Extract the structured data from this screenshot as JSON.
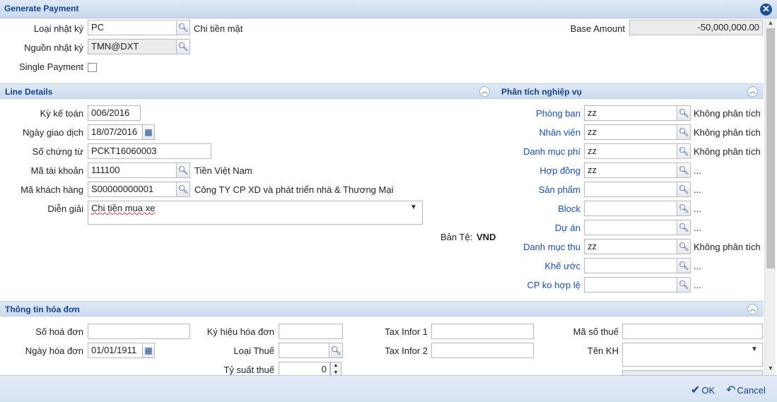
{
  "window": {
    "title": "Generate Payment"
  },
  "header": {
    "loai_nhat_ky": {
      "label": "Loại nhật ký",
      "value": "PC",
      "desc": "Chi tiền mặt"
    },
    "nguon_nhat_ky": {
      "label": "Nguồn nhật ký",
      "value": "TMN@DXT"
    },
    "single_payment": {
      "label": "Single Payment",
      "checked": false
    },
    "base_amount": {
      "label": "Base Amount",
      "value": "-50,000,000.00"
    }
  },
  "line_details": {
    "title": "Line Details",
    "ky_ke_toan": {
      "label": "Kỳ kế toán",
      "value": "006/2016"
    },
    "ngay_giao_dich": {
      "label": "Ngày giao dịch",
      "value": "18/07/2016"
    },
    "so_chung_tu": {
      "label": "Số chứng từ",
      "value": "PCKT16060003"
    },
    "ma_tai_khoan": {
      "label": "Mã tài khoản",
      "value": "111100",
      "desc": "Tiền Việt Nam"
    },
    "ma_khach_hang": {
      "label": "Mã khách hàng",
      "value": "S00000000001",
      "desc": "Công TY CP XD và phát triển nhà & Thương Mại"
    },
    "dien_giai": {
      "label": "Diễn giải",
      "value": "Chi tiền mua xe"
    },
    "ban_te": {
      "label": "Bản Tệ:",
      "value": "VND"
    }
  },
  "analysis": {
    "title": "Phân tích nghiệp vụ",
    "rows": [
      {
        "label": "Phòng ban",
        "value": "zz",
        "desc": "Không phân tích"
      },
      {
        "label": "Nhân viên",
        "value": "zz",
        "desc": "Không phân tích"
      },
      {
        "label": "Danh mục phí",
        "value": "zz",
        "desc": "Không phân tích"
      },
      {
        "label": "Hợp đồng",
        "value": "zz",
        "desc": "..."
      },
      {
        "label": "Sản phẩm",
        "value": "",
        "desc": "..."
      },
      {
        "label": "Block",
        "value": "",
        "desc": "..."
      },
      {
        "label": "Dự án",
        "value": "",
        "desc": "..."
      },
      {
        "label": "Danh mục thu",
        "value": "zz",
        "desc": "Không phân tích"
      },
      {
        "label": "Khế ước",
        "value": "",
        "desc": "..."
      },
      {
        "label": "CP ko hợp lệ",
        "value": "",
        "desc": "..."
      }
    ]
  },
  "invoice": {
    "title": "Thông tin hóa đơn",
    "so_hoa_don": {
      "label": "Số hoá đơn",
      "value": ""
    },
    "ngay_hoa_don": {
      "label": "Ngày hóa đơn",
      "value": "01/01/1911"
    },
    "ky_hieu_hoa_don": {
      "label": "Ký hiệu hóa đơn",
      "value": ""
    },
    "loai_thue": {
      "label": "Loại Thuế",
      "value": ""
    },
    "ty_suat_thue": {
      "label": "Tỷ suất thuế",
      "value": "0"
    },
    "tax_infor_1": {
      "label": "Tax Infor 1",
      "value": ""
    },
    "tax_infor_2": {
      "label": "Tax Infor 2",
      "value": ""
    },
    "ma_so_thue": {
      "label": "Mã số thuế",
      "value": ""
    },
    "ten_kh": {
      "label": "Tên KH",
      "value": ""
    }
  },
  "footer": {
    "ok_label": "OK",
    "cancel_label": "Cancel"
  },
  "icons": {
    "search": "search-icon",
    "calendar": "calendar-icon",
    "close": "close-icon",
    "collapse": "chevron-up-icon",
    "ok": "check-icon",
    "cancel": "undo-icon"
  },
  "colors": {
    "accent": "#15428b",
    "link": "#1a4fb0",
    "header_bg": "#dfe9f5"
  }
}
